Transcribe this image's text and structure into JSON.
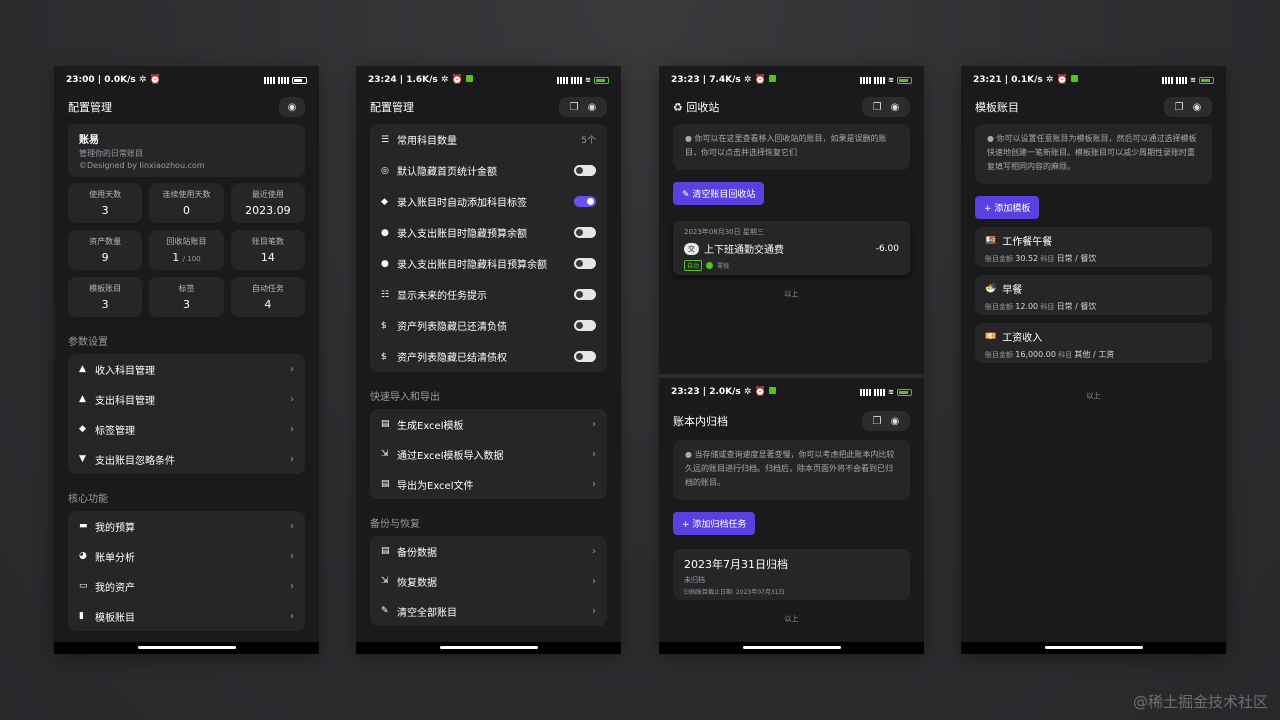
{
  "p1": {
    "status_time": "23:00 | 0.0K/s ✲ ⏰",
    "title": "配置管理",
    "ledger_name": "账易",
    "ledger_desc": "管理你的日常账目",
    "ledger_credit": "©Designed by linxiaozhou.com",
    "stats": [
      {
        "label": "使用天数",
        "value": "3"
      },
      {
        "label": "连续使用天数",
        "value": "0"
      },
      {
        "label": "最近使用",
        "value": "2023.09"
      },
      {
        "label": "资产数量",
        "value": "9"
      },
      {
        "label": "回收站账目",
        "value": "1",
        "suffix": "/ 100"
      },
      {
        "label": "账目笔数",
        "value": "14"
      },
      {
        "label": "模板账目",
        "value": "3"
      },
      {
        "label": "标签",
        "value": "3"
      },
      {
        "label": "自动任务",
        "value": "4"
      }
    ],
    "section_params": "参数设置",
    "params": [
      "收入科目管理",
      "支出科目管理",
      "标签管理",
      "支出账目忽略条件"
    ],
    "section_core": "核心功能",
    "core": [
      "我的预算",
      "账单分析",
      "我的资产",
      "模板账目"
    ]
  },
  "p2": {
    "status_time": "23:24 | 1.6K/s ✲ ⏰",
    "title": "配置管理",
    "count_label": "常用科目数量",
    "count_value": "5个",
    "toggles": [
      {
        "label": "默认隐藏首页统计金额"
      },
      {
        "label": "录入账目时自动添加科目标签",
        "on": true
      },
      {
        "label": "录入支出账目时隐藏预算余额"
      },
      {
        "label": "录入支出账目时隐藏科目预算余额"
      },
      {
        "label": "显示未来的任务提示"
      },
      {
        "label": "资产列表隐藏已还清负债"
      },
      {
        "label": "资产列表隐藏已结清债权"
      }
    ],
    "section_io": "快速导入和导出",
    "io": [
      "生成Excel模板",
      "通过Excel模板导入数据",
      "导出为Excel文件"
    ],
    "section_backup": "备份与恢复",
    "backup": [
      "备份数据",
      "恢复数据",
      "清空全部账目"
    ]
  },
  "p3": {
    "status_time": "23:23 | 7.4K/s ✲ ⏰",
    "title": "回收站",
    "tip": "你可以在这里查看移入回收站的账目，如果是误删的账目，你可以点击并选择恢复它们",
    "clear_btn": "清空账目回收站",
    "item_date": "2023年08月30日 星期三",
    "item_badge": "交",
    "item_name": "上下班通勤交通费",
    "item_amount": "-6.00",
    "item_tag": "自动",
    "item_account": "零钱",
    "end": "以上",
    "status_time2": "23:23 | 2.0K/s ✲ ⏰",
    "title2": "账本内归档",
    "tip2": "当存储或查询速度显著变慢，你可以考虑把此账本内比较久远的账目进行归档。归档后，除本页面外将不会看到已归档的账目。",
    "add_btn": "添加归档任务",
    "arch_title": "2023年7月31日归档",
    "arch_status": "未归档",
    "arch_range": "归档账目截止日期: 2023年07月31日",
    "end2": "以上"
  },
  "p4": {
    "status_time": "23:21 | 0.1K/s ✲ ⏰",
    "title": "模板账目",
    "tip": "你可以设置任意账目为模板账目，然后可以通过选择模板快速地创建一笔新账目。模板账目可以减少周期性录账时重复填写相同内容的麻烦。",
    "add_btn": "添加模板",
    "templates": [
      {
        "emoji": "🍱",
        "name": "工作餐午餐",
        "amount_label": "账目金额",
        "amount": "30.52",
        "cat_label": "科目",
        "cat": "日常 / 餐饮"
      },
      {
        "emoji": "🍜",
        "name": "早餐",
        "amount_label": "账目金额",
        "amount": "12.00",
        "cat_label": "科目",
        "cat": "日常 / 餐饮"
      },
      {
        "emoji": "💴",
        "name": "工资收入",
        "amount_label": "账目金额",
        "amount": "16,000.00",
        "cat_label": "科目",
        "cat": "其他 / 工资"
      }
    ],
    "end": "以上"
  },
  "watermark": "@稀土掘金技术社区"
}
